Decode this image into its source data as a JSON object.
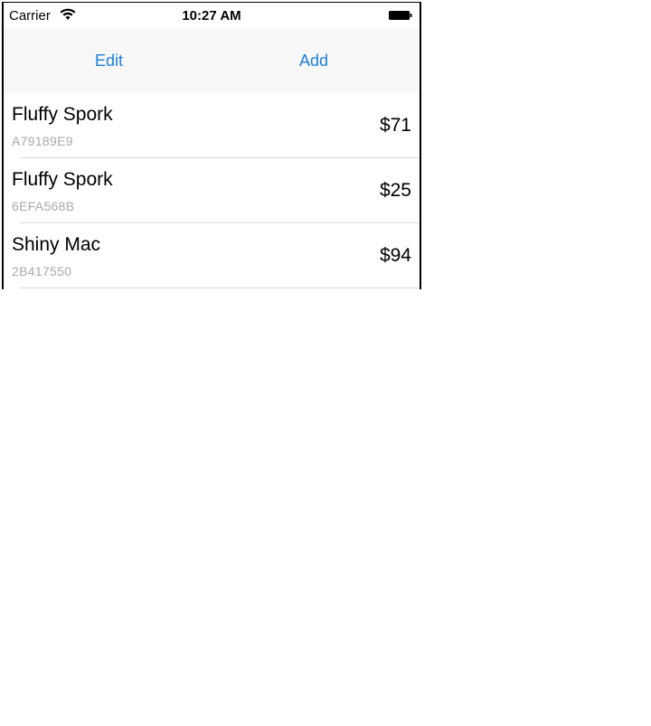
{
  "status_bar": {
    "carrier": "Carrier",
    "time": "10:27 AM"
  },
  "toolbar": {
    "edit_label": "Edit",
    "add_label": "Add"
  },
  "items": [
    {
      "name": "Fluffy Spork",
      "code": "A79189E9",
      "price": "$71"
    },
    {
      "name": "Fluffy Spork",
      "code": "6EFA568B",
      "price": "$25"
    },
    {
      "name": "Shiny Mac",
      "code": "2B417550",
      "price": "$94"
    }
  ],
  "colors": {
    "accent": "#1a7fe0",
    "secondary_text": "#a9a9a9"
  }
}
